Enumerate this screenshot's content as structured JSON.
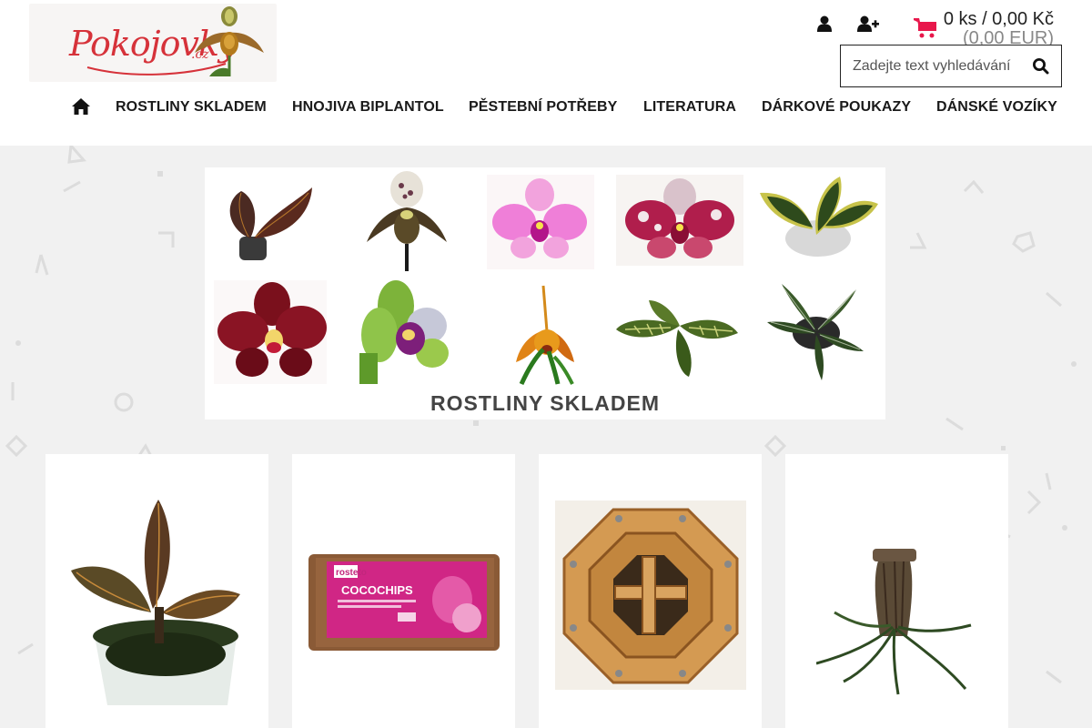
{
  "logo": {
    "text": "Pokojovky",
    "tld": ".cz"
  },
  "header": {
    "user_icon": "user-icon",
    "register_icon": "user-plus-icon",
    "cart": {
      "icon": "shopping-cart-icon",
      "summary": "0 ks / 0,00 Kč",
      "eur": "(0,00 EUR)"
    },
    "search": {
      "placeholder": "Zadejte text vyhledávání",
      "icon": "search-icon"
    }
  },
  "nav": {
    "home_icon": "home-icon",
    "items": [
      "ROSTLINY SKLADEM",
      "HNOJIVA BIPLANTOL",
      "PĚSTEBNÍ POTŘEBY",
      "LITERATURA",
      "DÁRKOVÉ POUKAZY",
      "DÁNSKÉ VOZÍKY"
    ]
  },
  "banner": {
    "title": "ROSTLINY SKLADEM"
  },
  "products": [
    {
      "image": "jewel-orchid-plant-image"
    },
    {
      "image": "cocochips-substrate-image",
      "brand": "rosteto",
      "product": "COCOCHIPS"
    },
    {
      "image": "wooden-basket-image"
    },
    {
      "image": "orchid-on-cork-image"
    }
  ],
  "colors": {
    "accent": "#e8174b",
    "logo": "#d6323a",
    "background": "#f1f1f1",
    "nav_text": "#1a1a1a"
  }
}
